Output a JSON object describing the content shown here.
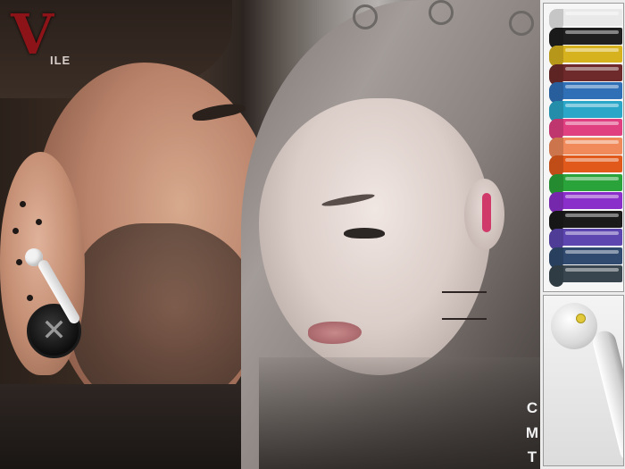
{
  "logo": {
    "letter": "V",
    "rest": "ILE"
  },
  "corner_letters": [
    "C",
    "M",
    "T"
  ],
  "swatches": [
    {
      "color": "#e9e9e9"
    },
    {
      "color": "#1f1f1f"
    },
    {
      "color": "#d7b21f"
    },
    {
      "color": "#6e2a2a"
    },
    {
      "color": "#2f6fb6"
    },
    {
      "color": "#2aa7c8"
    },
    {
      "color": "#e04080"
    },
    {
      "color": "#f08a5a"
    },
    {
      "color": "#e25a1b"
    },
    {
      "color": "#2aa43a"
    },
    {
      "color": "#8a2fc9"
    },
    {
      "color": "#1a1a1a"
    },
    {
      "color": "#5d46b0"
    },
    {
      "color": "#2f4a6e"
    },
    {
      "color": "#39464f"
    }
  ]
}
